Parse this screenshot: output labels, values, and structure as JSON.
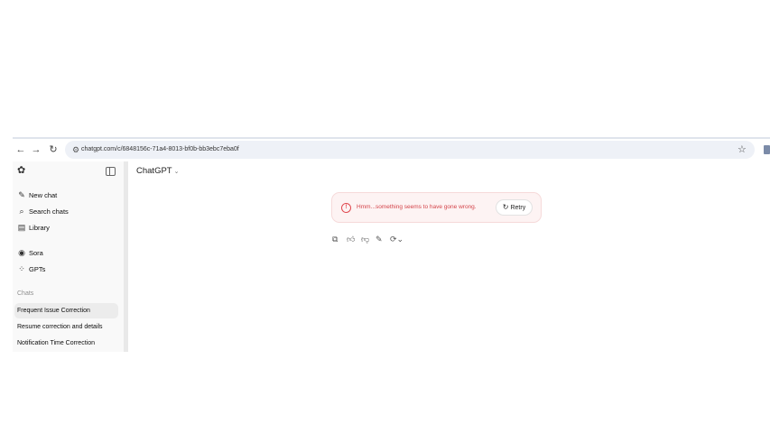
{
  "browser": {
    "url": "chatgpt.com/c/6848156c-71a4-8013-bf0b-bb3ebc7eba0f"
  },
  "sidebar": {
    "items": [
      {
        "icon": "pencil-square-icon",
        "label": "New chat"
      },
      {
        "icon": "search-icon",
        "label": "Search chats"
      },
      {
        "icon": "library-icon",
        "label": "Library"
      },
      {
        "icon": "sora-icon",
        "label": "Sora"
      },
      {
        "icon": "grid-icon",
        "label": "GPTs"
      }
    ],
    "chats_heading": "Chats",
    "chats": [
      {
        "label": "Frequent Issue Correction",
        "active": true
      },
      {
        "label": "Resume correction and details",
        "active": false
      },
      {
        "label": "Notification Time Correction",
        "active": false
      }
    ]
  },
  "main": {
    "model_label": "ChatGPT",
    "error": {
      "message": "Hmm...something seems to have gone wrong.",
      "retry_label": "Retry",
      "color": "#d4444a"
    },
    "actions": [
      "copy-icon",
      "thumbs-up-icon",
      "thumbs-down-icon",
      "edit-icon",
      "regenerate-icon"
    ]
  }
}
